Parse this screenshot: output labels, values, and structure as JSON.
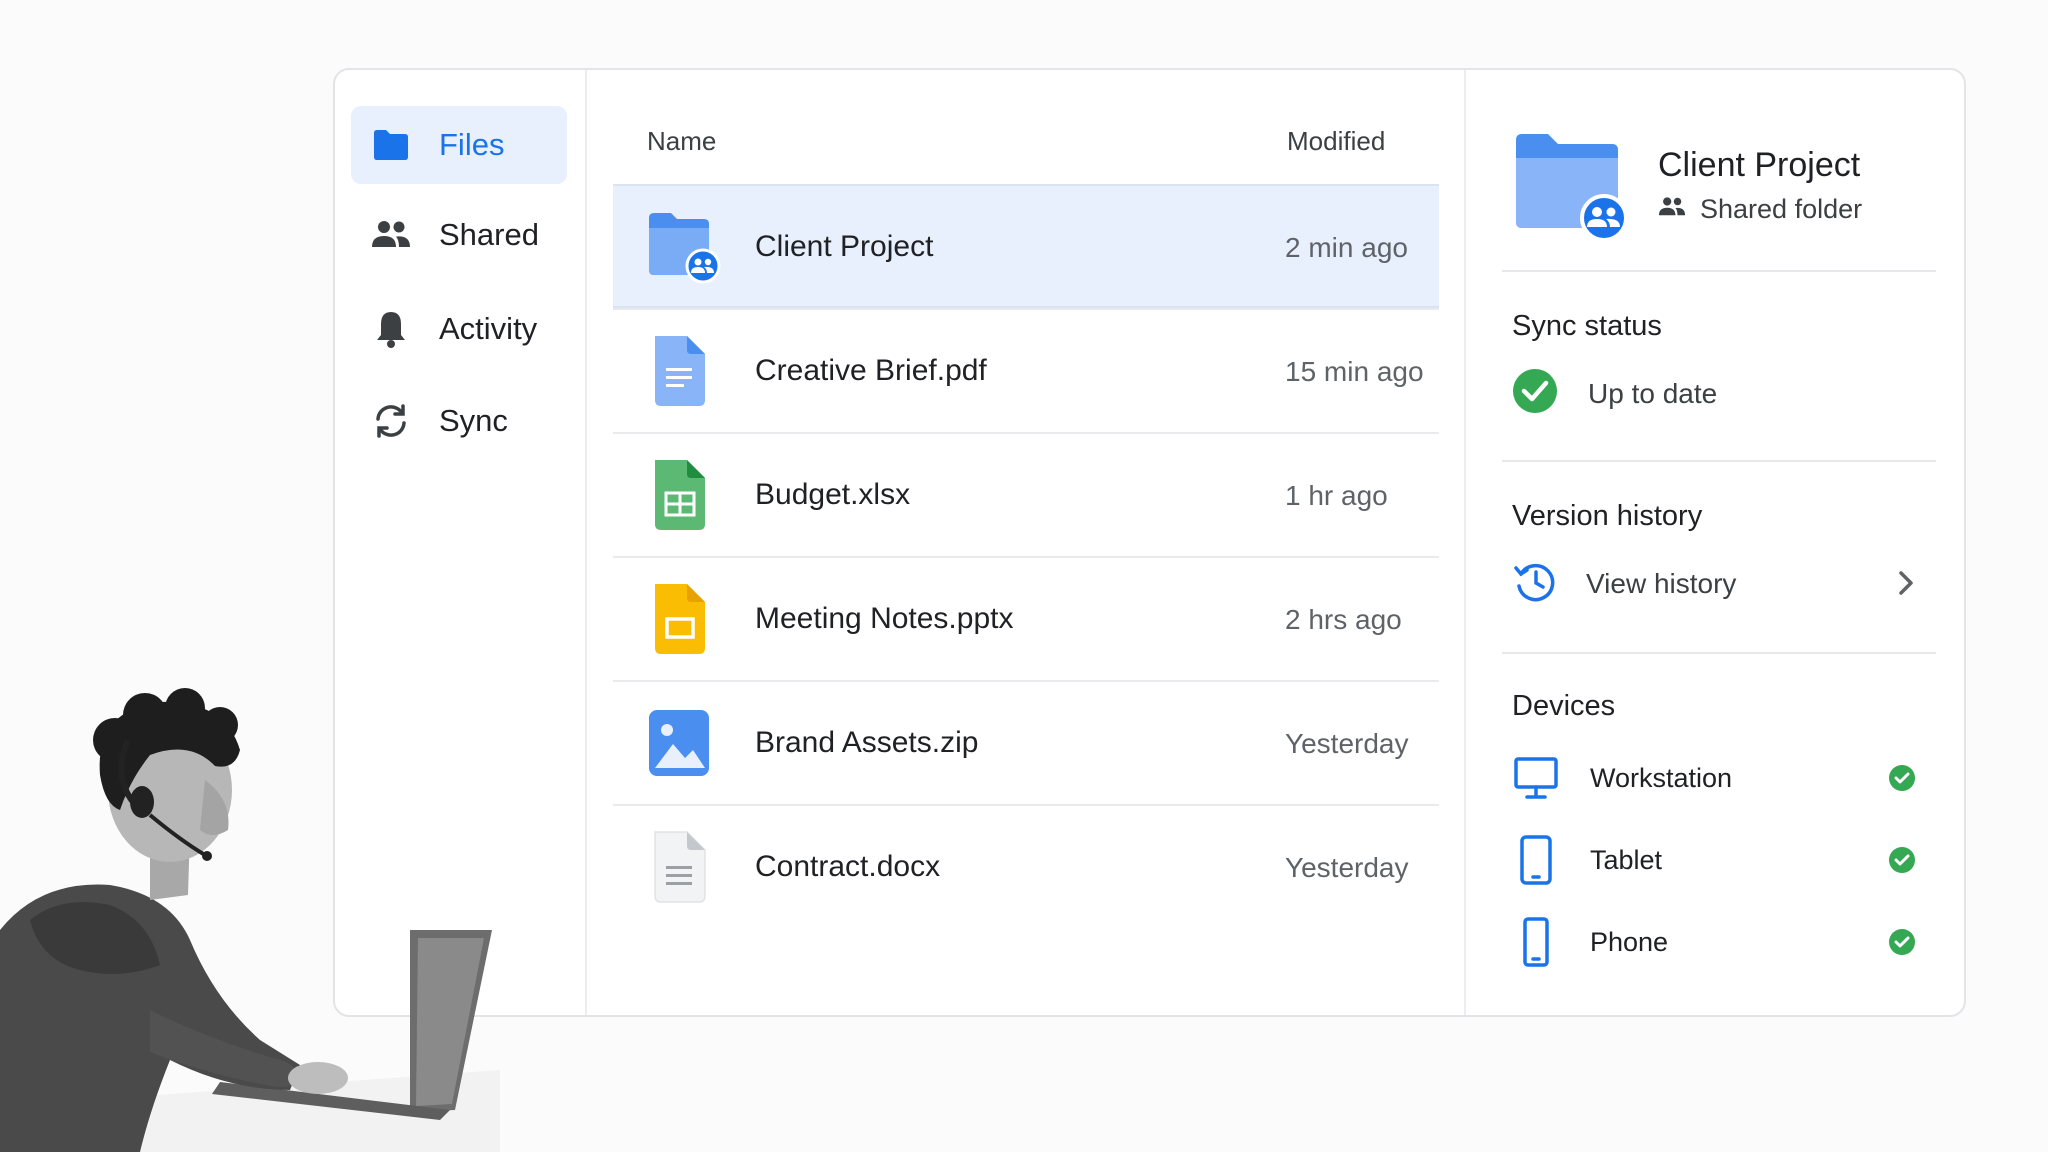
{
  "sidebar": {
    "items": [
      {
        "label": "Files",
        "icon": "folder-icon",
        "active": true
      },
      {
        "label": "Shared",
        "icon": "people-icon"
      },
      {
        "label": "Activity",
        "icon": "bell-icon"
      },
      {
        "label": "Sync",
        "icon": "sync-icon"
      }
    ]
  },
  "list": {
    "columns": {
      "name": "Name",
      "modified": "Modified"
    },
    "rows": [
      {
        "name": "Client Project",
        "modified": "2 min ago",
        "icon": "shared-folder-icon",
        "selected": true
      },
      {
        "name": "Creative Brief.pdf",
        "modified": "15 min ago",
        "icon": "doc-icon"
      },
      {
        "name": "Budget.xlsx",
        "modified": "1 hr ago",
        "icon": "sheet-icon"
      },
      {
        "name": "Meeting Notes.pptx",
        "modified": "2 hrs ago",
        "icon": "slides-icon"
      },
      {
        "name": "Brand Assets.zip",
        "modified": "Yesterday",
        "icon": "image-icon"
      },
      {
        "name": "Contract.docx",
        "modified": "Yesterday",
        "icon": "text-file-icon"
      }
    ]
  },
  "details": {
    "title": "Client Project",
    "subtitle": "Shared folder",
    "sync": {
      "title": "Sync status",
      "status": "Up to date"
    },
    "version": {
      "title": "Version history",
      "link": "View history"
    },
    "devices": {
      "title": "Devices",
      "items": [
        {
          "label": "Workstation",
          "icon": "monitor-icon",
          "synced": true
        },
        {
          "label": "Tablet",
          "icon": "tablet-icon",
          "synced": true
        },
        {
          "label": "Phone",
          "icon": "phone-icon",
          "synced": true
        }
      ]
    }
  },
  "colors": {
    "accent": "#1a73e8",
    "selected_bg": "#e8f0fe",
    "success": "#34a853",
    "sheet_green": "#34a853",
    "slides_yellow": "#fbbc04"
  }
}
